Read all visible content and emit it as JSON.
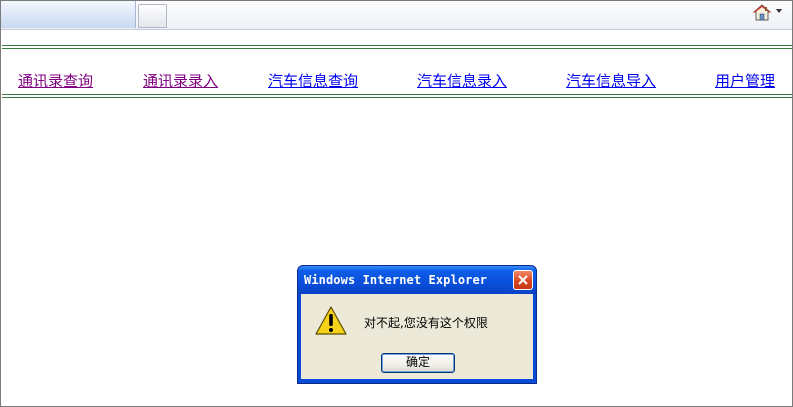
{
  "browser": {
    "home_icon": "home-icon",
    "new_tab_icon": "new-tab-icon"
  },
  "nav": {
    "items": [
      {
        "label": "通讯录查询",
        "state": "visited"
      },
      {
        "label": "通讯录录入",
        "state": "visited"
      },
      {
        "label": "汽车信息查询",
        "state": "unvisited"
      },
      {
        "label": "汽车信息录入",
        "state": "unvisited"
      },
      {
        "label": "汽车信息导入",
        "state": "unvisited"
      },
      {
        "label": "用户管理",
        "state": "unvisited"
      }
    ],
    "colors": {
      "visited": "#800080",
      "unvisited": "#0000ee",
      "rule": "#3a7a3a"
    }
  },
  "dialog": {
    "title": "Windows Internet Explorer",
    "message": "对不起,您没有这个权限",
    "ok_label": "确定",
    "icon": "warning-icon",
    "title_color": "#0a4fdc"
  }
}
